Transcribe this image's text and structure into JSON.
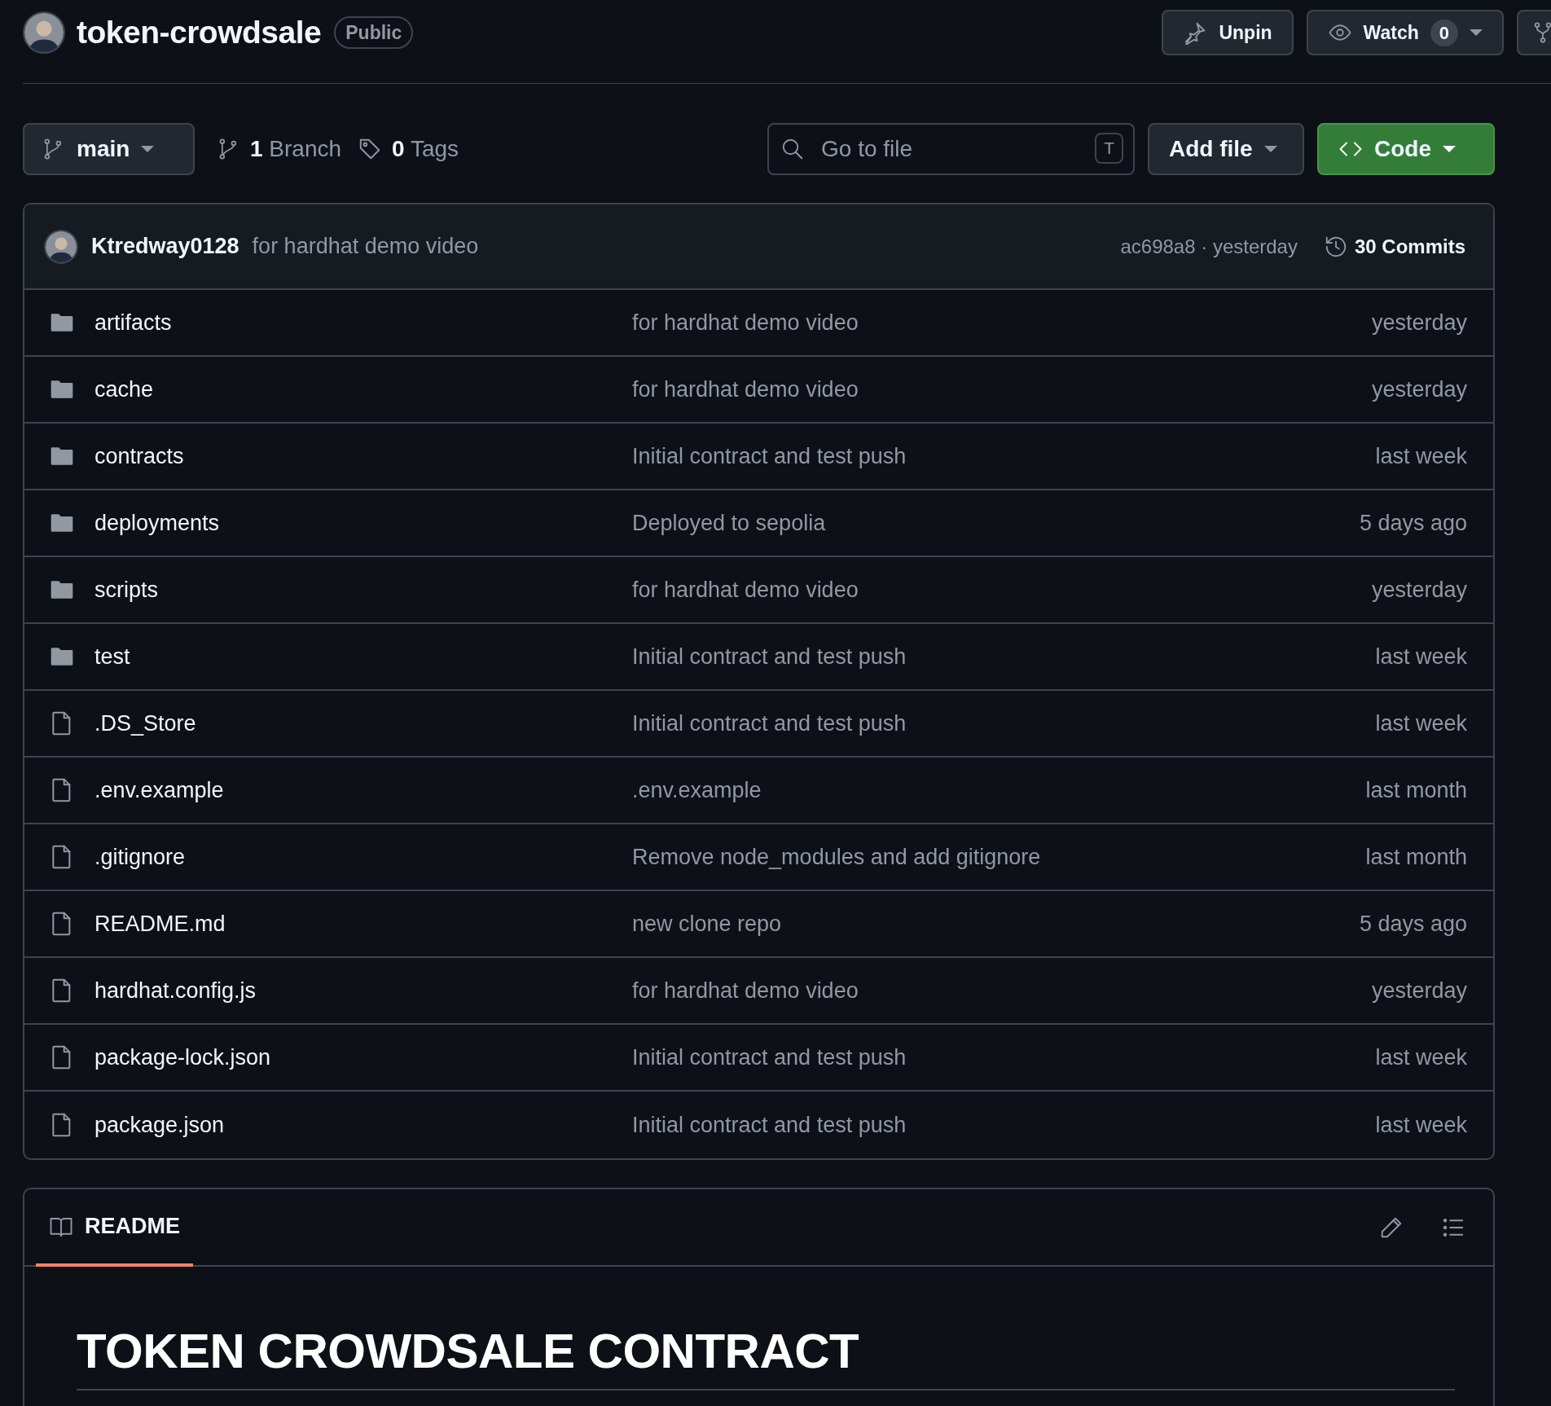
{
  "repo": {
    "title": "token-crowdsale",
    "visibility": "Public"
  },
  "header_buttons": [
    {
      "kind": "pin",
      "label": "Unpin"
    },
    {
      "kind": "watch",
      "label": "Watch",
      "count": "0"
    },
    {
      "kind": "fork"
    }
  ],
  "toolbar": {
    "branch": "main",
    "branch_count": "1",
    "branch_label": "Branch",
    "tag_count": "0",
    "tag_label": "Tags",
    "search": {
      "placeholder": "Go to file",
      "shortcut": "T"
    },
    "add_file": "Add file",
    "code": "Code"
  },
  "latest_commit": {
    "author": "Ktredway0128",
    "message": "for hardhat demo video",
    "hash": "ac698a8",
    "separator": "·",
    "time": "yesterday",
    "commit_count": "30",
    "commit_label": "Commits"
  },
  "files": [
    {
      "kind": "folder",
      "name": "artifacts",
      "message": "for hardhat demo video",
      "time": "yesterday"
    },
    {
      "kind": "folder",
      "name": "cache",
      "message": "for hardhat demo video",
      "time": "yesterday"
    },
    {
      "kind": "folder",
      "name": "contracts",
      "message": "Initial contract and test push",
      "time": "last week"
    },
    {
      "kind": "folder",
      "name": "deployments",
      "message": "Deployed to sepolia",
      "time": "5 days ago"
    },
    {
      "kind": "folder",
      "name": "scripts",
      "message": "for hardhat demo video",
      "time": "yesterday"
    },
    {
      "kind": "folder",
      "name": "test",
      "message": "Initial contract and test push",
      "time": "last week"
    },
    {
      "kind": "file",
      "name": ".DS_Store",
      "message": "Initial contract and test push",
      "time": "last week"
    },
    {
      "kind": "file",
      "name": ".env.example",
      "message": ".env.example",
      "time": "last month"
    },
    {
      "kind": "file",
      "name": ".gitignore",
      "message": "Remove node_modules and add gitignore",
      "time": "last month"
    },
    {
      "kind": "file",
      "name": "README.md",
      "message": "new clone repo",
      "time": "5 days ago"
    },
    {
      "kind": "file",
      "name": "hardhat.config.js",
      "message": "for hardhat demo video",
      "time": "yesterday"
    },
    {
      "kind": "file",
      "name": "package-lock.json",
      "message": "Initial contract and test push",
      "time": "last week"
    },
    {
      "kind": "file",
      "name": "package.json",
      "message": "Initial contract and test push",
      "time": "last week"
    }
  ],
  "readme": {
    "tabs": [
      {
        "label": "README",
        "selected": true
      }
    ],
    "heading": "TOKEN CROWDSALE CONTRACT"
  }
}
